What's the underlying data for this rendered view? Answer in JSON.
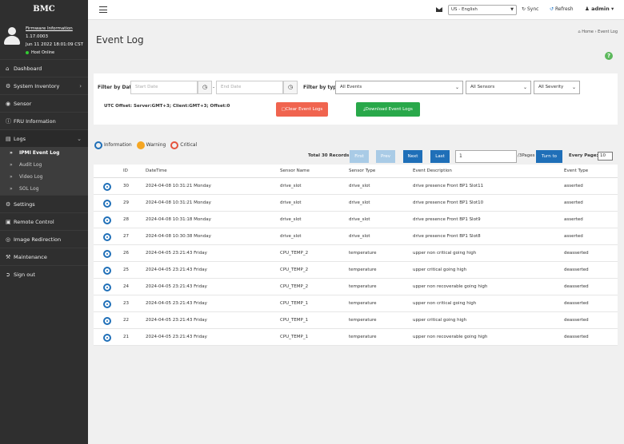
{
  "brand": "BMC",
  "profile": {
    "firmware_link": "Firmware Information",
    "version": "1.17.0003",
    "date": "Jun 11 2022 18:01:09 CST",
    "host_status": "Host Online"
  },
  "nav": {
    "dashboard": "Dashboard",
    "system_inventory": "System Inventory",
    "sensor": "Sensor",
    "fru": "FRU Information",
    "logs": "Logs",
    "logs_sub": [
      "IPMI Event Log",
      "Audit Log",
      "Video Log",
      "SOL Log"
    ],
    "settings": "Settings",
    "remote_control": "Remote Control",
    "image_redirection": "Image Redirection",
    "maintenance": "Maintenance",
    "sign_out": "Sign out"
  },
  "topbar": {
    "language": "US - English",
    "sync": "Sync",
    "refresh": "Refresh",
    "user": "admin"
  },
  "page": {
    "title": "Event Log",
    "breadcrumb_home": "Home",
    "breadcrumb_current": "Event Log"
  },
  "filters": {
    "by_date_label": "Filter by Date",
    "start_placeholder": "Start Date",
    "end_placeholder": "End Date",
    "by_type_label": "Filter by type",
    "type_value": "All Events",
    "sensor_value": "All Sensors",
    "severity_value": "All Severity",
    "utc_offset": "UTC Offset:  Server:GMT+3; Client:GMT+3; Offset:0",
    "clear_label": "Clear Event Logs",
    "download_label": "Download Event Logs"
  },
  "legend": {
    "information": "Information",
    "warning": "Warning",
    "critical": "Critical"
  },
  "pager": {
    "total": "Total 30 Records",
    "first": "First",
    "prev": "Prev",
    "next": "Next",
    "last": "Last",
    "page_value": "1",
    "pages": "/3Pages",
    "turn_to": "Turn to",
    "every_page_label": "Every Page:",
    "page_size": "10"
  },
  "table": {
    "headers": [
      "ID",
      "DateTime",
      "Sensor Name",
      "Sensor Type",
      "Event Description",
      "Event Type"
    ],
    "rows": [
      {
        "id": "30",
        "datetime": "2024-04-08 10:31:21 Monday",
        "sensor_name": "drive_slot",
        "sensor_type": "drive_slot",
        "description": "drive presence Front BP1 Slot11",
        "event_type": "asserted"
      },
      {
        "id": "29",
        "datetime": "2024-04-08 10:31:21 Monday",
        "sensor_name": "drive_slot",
        "sensor_type": "drive_slot",
        "description": "drive presence Front BP1 Slot10",
        "event_type": "asserted"
      },
      {
        "id": "28",
        "datetime": "2024-04-08 10:31:18 Monday",
        "sensor_name": "drive_slot",
        "sensor_type": "drive_slot",
        "description": "drive presence Front BP1 Slot9",
        "event_type": "asserted"
      },
      {
        "id": "27",
        "datetime": "2024-04-08 10:30:38 Monday",
        "sensor_name": "drive_slot",
        "sensor_type": "drive_slot",
        "description": "drive presence Front BP1 Slot8",
        "event_type": "asserted"
      },
      {
        "id": "26",
        "datetime": "2024-04-05 23:21:43 Friday",
        "sensor_name": "CPU_TEMP_2",
        "sensor_type": "temperature",
        "description": "upper non critical going high",
        "event_type": "deasserted"
      },
      {
        "id": "25",
        "datetime": "2024-04-05 23:21:43 Friday",
        "sensor_name": "CPU_TEMP_2",
        "sensor_type": "temperature",
        "description": "upper critical going high",
        "event_type": "deasserted"
      },
      {
        "id": "24",
        "datetime": "2024-04-05 23:21:43 Friday",
        "sensor_name": "CPU_TEMP_2",
        "sensor_type": "temperature",
        "description": "upper non recoverable going high",
        "event_type": "deasserted"
      },
      {
        "id": "23",
        "datetime": "2024-04-05 23:21:43 Friday",
        "sensor_name": "CPU_TEMP_1",
        "sensor_type": "temperature",
        "description": "upper non critical going high",
        "event_type": "deasserted"
      },
      {
        "id": "22",
        "datetime": "2024-04-05 23:21:43 Friday",
        "sensor_name": "CPU_TEMP_1",
        "sensor_type": "temperature",
        "description": "upper critical going high",
        "event_type": "deasserted"
      },
      {
        "id": "21",
        "datetime": "2024-04-05 23:21:43 Friday",
        "sensor_name": "CPU_TEMP_1",
        "sensor_type": "temperature",
        "description": "upper non recoverable going high",
        "event_type": "deasserted"
      }
    ]
  },
  "colors": {
    "sidebar_bg": "#2f2f2f",
    "primary": "#1f6fb8",
    "danger": "#f0644f",
    "success": "#29a84a",
    "warning": "#f5a623"
  }
}
